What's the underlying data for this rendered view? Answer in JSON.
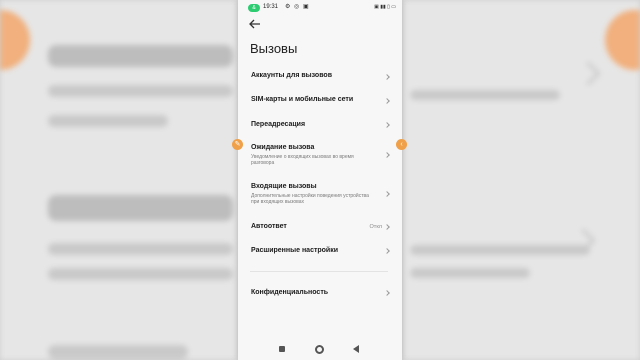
{
  "status_bar": {
    "call_indicator": "&",
    "time": "19:31",
    "left_icons": "⚙ ◎ ▣",
    "right_icons": "▣ ▮▮ ▯ ▭"
  },
  "header": {
    "back_icon": "arrow-left-icon",
    "title": "Вызовы"
  },
  "settings": {
    "items": [
      {
        "label": "Аккаунты для вызовов"
      },
      {
        "label": "SIM-карты и мобильные сети"
      },
      {
        "label": "Переадресация"
      },
      {
        "label": "Ожидание вызова",
        "sublabel": "Уведомление о входящих вызовах во время разговора"
      },
      {
        "label": "Входящие вызовы",
        "sublabel": "Дополнительные настройки поведения устройства при входящих вызовах"
      },
      {
        "label": "Автоответ",
        "value": "Откл"
      },
      {
        "label": "Расширенные настройки"
      },
      {
        "label": "Конфиденциальность"
      }
    ]
  },
  "nav_bar": {
    "recents_icon": "square-icon",
    "home_icon": "circle-icon",
    "back_icon": "triangle-back-icon"
  },
  "colors": {
    "accent_orange": "#f0a048",
    "call_green": "#2ecc71",
    "panel_bg": "#f7f7f7",
    "text_primary": "#1b1b1b",
    "text_secondary": "#7a7a7a"
  }
}
